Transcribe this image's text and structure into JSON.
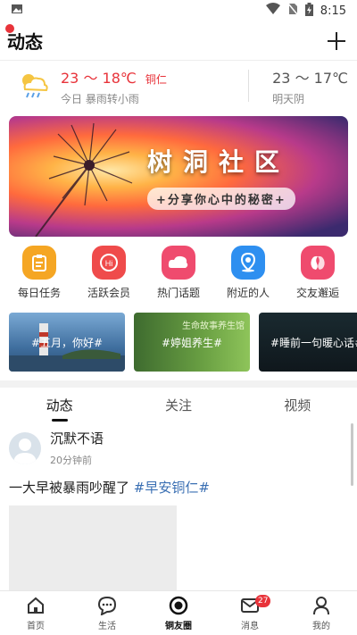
{
  "status_bar": {
    "time": "8:15"
  },
  "header": {
    "title": "动态"
  },
  "weather": {
    "today_temp": "23 ～ 18℃",
    "city": "铜仁",
    "today_desc": "今日 暴雨转小雨",
    "tomorrow_temp": "23 ～ 17℃",
    "tomorrow_desc": "明天阴"
  },
  "banner": {
    "title": "树洞社区",
    "subtitle": "+分享你心中的秘密+"
  },
  "quick_links": [
    {
      "label": "每日任务",
      "icon": "clipboard-icon",
      "color": "#f5a623"
    },
    {
      "label": "活跃会员",
      "icon": "hi-icon",
      "color": "#ef4b4b"
    },
    {
      "label": "热门话题",
      "icon": "chat-cloud-icon",
      "color": "#ef4b6e"
    },
    {
      "label": "附近的人",
      "icon": "location-icon",
      "color": "#2e8ff0"
    },
    {
      "label": "交友邂逅",
      "icon": "couple-icon",
      "color": "#ef4b6e"
    }
  ],
  "topics": [
    {
      "label": "#五月，你好#"
    },
    {
      "label": "#婷姐养生#",
      "overlay": "生命故事养生馆"
    },
    {
      "label": "#睡前一句暖心话#"
    }
  ],
  "feed_tabs": [
    {
      "label": "动态",
      "active": true
    },
    {
      "label": "关注",
      "active": false
    },
    {
      "label": "视频",
      "active": false
    }
  ],
  "post": {
    "author": "沉默不语",
    "time": "20分钟前",
    "text": "一大早被暴雨吵醒了 ",
    "tag": "#早安铜仁#"
  },
  "tab_bar": [
    {
      "label": "首页",
      "icon": "home-icon"
    },
    {
      "label": "生活",
      "icon": "chat-bubble-icon"
    },
    {
      "label": "铜友圈",
      "icon": "circle-icon",
      "active": true
    },
    {
      "label": "消息",
      "icon": "mail-icon",
      "badge": "27"
    },
    {
      "label": "我的",
      "icon": "user-icon"
    }
  ]
}
